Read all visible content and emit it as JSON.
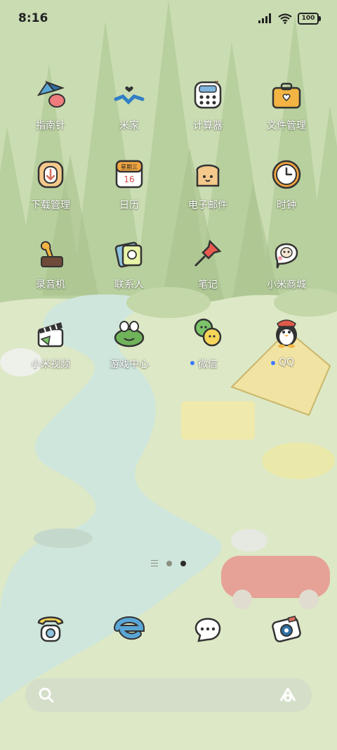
{
  "status_bar": {
    "time": "8:16",
    "battery": "100"
  },
  "apps": [
    {
      "label": "指南针",
      "icon": "compass-icon"
    },
    {
      "label": "米家",
      "icon": "mijia-icon"
    },
    {
      "label": "计算器",
      "icon": "calculator-icon"
    },
    {
      "label": "文件管理",
      "icon": "briefcase-folder-icon"
    },
    {
      "label": "下载管理",
      "icon": "download-toast-icon"
    },
    {
      "label": "日历",
      "icon": "calendar-icon",
      "calendar_weekday": "星期三",
      "calendar_day": "16"
    },
    {
      "label": "电子邮件",
      "icon": "bread-mail-icon"
    },
    {
      "label": "时钟",
      "icon": "clock-icon"
    },
    {
      "label": "录音机",
      "icon": "gramophone-icon"
    },
    {
      "label": "联系人",
      "icon": "contacts-book-icon"
    },
    {
      "label": "笔记",
      "icon": "pushpin-icon"
    },
    {
      "label": "小米商城",
      "icon": "dog-speech-bubble-icon"
    },
    {
      "label": "小米视频",
      "icon": "clapperboard-icon"
    },
    {
      "label": "游戏中心",
      "icon": "frog-gamepad-icon"
    },
    {
      "label": "微信",
      "icon": "wechat-chicks-icon",
      "new_dot": true
    },
    {
      "label": "QQ",
      "icon": "penguin-icon",
      "new_dot": true
    }
  ],
  "dock": [
    {
      "icon": "phone-icon"
    },
    {
      "icon": "browser-e-icon"
    },
    {
      "icon": "messages-bubble-icon"
    },
    {
      "icon": "camera-icon"
    }
  ],
  "pager": {
    "pages": 2,
    "active": 2
  },
  "search_bar": {
    "left_icon": "search-icon",
    "right_icon": "assistant-icon"
  },
  "colors": {
    "dot_blue": "#3d7bff",
    "label": "#ffffff"
  }
}
